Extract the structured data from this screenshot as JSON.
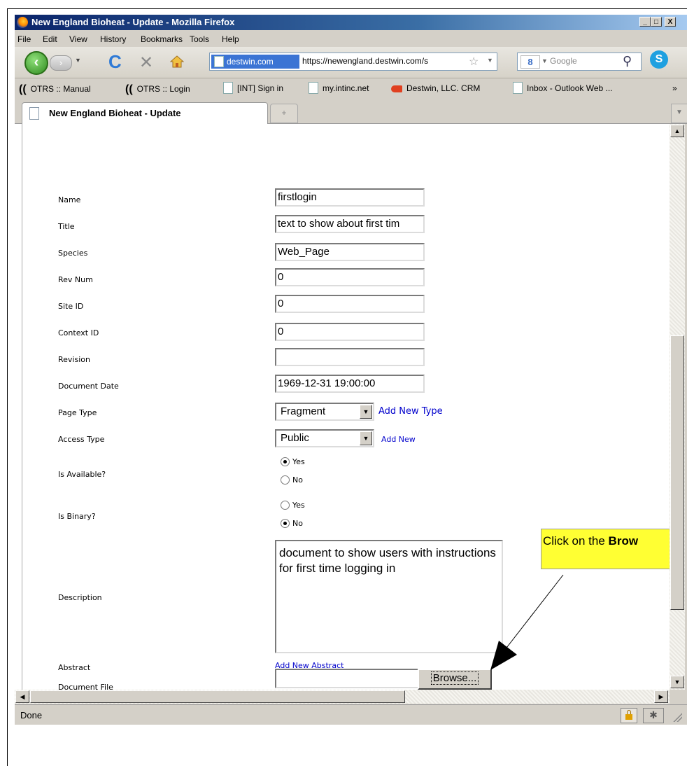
{
  "window": {
    "title": "New England Bioheat - Update - Mozilla Firefox",
    "controls": [
      "_",
      "□",
      "X"
    ]
  },
  "menu": [
    "File",
    "Edit",
    "View",
    "History",
    "Bookmarks",
    "Tools",
    "Help"
  ],
  "nav": {
    "identity": "destwin.com",
    "url": "https://newengland.destwin.com/s",
    "search_placeholder": "Google"
  },
  "bookmarks": [
    "OTRS :: Manual",
    "OTRS :: Login",
    "[INT] Sign in",
    "my.intinc.net",
    "Destwin, LLC. CRM",
    "Inbox - Outlook Web ...",
    "»"
  ],
  "tab": {
    "title": "New England Bioheat - Update",
    "new_tab": "+"
  },
  "form": {
    "labels": {
      "name": "Name",
      "title": "Title",
      "species": "Species",
      "rev_num": "Rev Num",
      "site_id": "Site ID",
      "context_id": "Context ID",
      "revision": "Revision",
      "document_date": "Document Date",
      "page_type": "Page Type",
      "access_type": "Access Type",
      "is_available": "Is Available?",
      "is_binary": "Is Binary?",
      "description": "Description",
      "abstract": "Abstract",
      "document_file": "Document File"
    },
    "values": {
      "name": "firstlogin",
      "title": "text to show about first tim",
      "species": "Web_Page",
      "rev_num": "0",
      "site_id": "0",
      "context_id": "0",
      "revision": "",
      "document_date": "1969-12-31 19:00:00",
      "page_type": "Fragment",
      "access_type": "Public",
      "description": "document to show users with instructions for first time logging in"
    },
    "radio": {
      "yes": "Yes",
      "no": "No",
      "is_available": "Yes",
      "is_binary": "No"
    },
    "links": {
      "add_new_type": "Add New Type",
      "add_new": "Add New",
      "add_new_abstract": "Add New Abstract"
    },
    "browse_label": "Browse..."
  },
  "callout": {
    "prefix": "Click on the ",
    "bold": "Brow"
  },
  "status": {
    "text": "Done"
  }
}
